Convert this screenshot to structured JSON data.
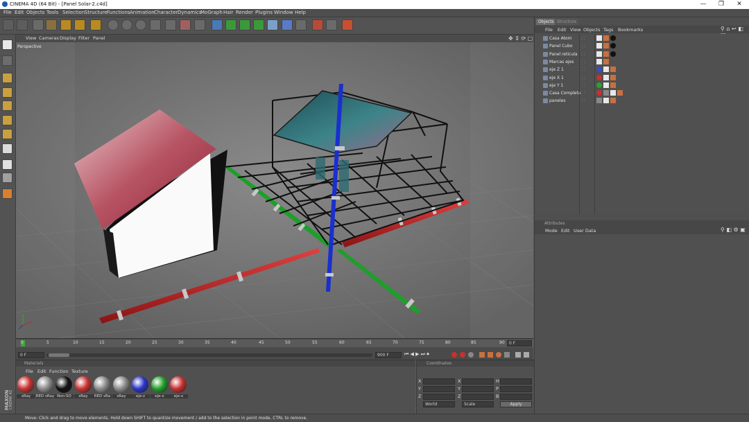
{
  "window": {
    "title": "CINEMA 4D (64 Bit) - [Panel Solar-2.c4d]",
    "controls": [
      "—",
      "❐",
      "✕"
    ]
  },
  "menubar": [
    "File",
    "Edit",
    "Objects",
    "Tools",
    "Selection",
    "Structure",
    "Functions",
    "Animation",
    "Character",
    "Dynamics",
    "MoGraph",
    "Hair",
    "Render",
    "Plugins",
    "Window",
    "Help"
  ],
  "viewport": {
    "menu": [
      "View",
      "Cameras",
      "Display",
      "Filter",
      "Panel"
    ],
    "label": "Perspective"
  },
  "timeline": {
    "ticks": [
      "0",
      "5",
      "10",
      "15",
      "20",
      "25",
      "30",
      "35",
      "40",
      "45",
      "50",
      "55",
      "60",
      "65",
      "70",
      "75",
      "80",
      "85",
      "90"
    ],
    "current_frame": "0 F",
    "start_field": "0 F",
    "end_field": "900 F",
    "right_field": "0 F"
  },
  "materials": {
    "panel_title": "Materials",
    "menu": [
      "File",
      "Edit",
      "Function",
      "Texture"
    ],
    "items": [
      {
        "label": "sRay",
        "color": "#c83232"
      },
      {
        "label": "RED sRay",
        "color": "#8a8a8a"
      },
      {
        "label": "Non-SO",
        "color": "#101010"
      },
      {
        "label": "sRay",
        "color": "#c83232"
      },
      {
        "label": "RED sRa",
        "color": "#8a8a8a"
      },
      {
        "label": "sRay",
        "color": "#8a8a8a"
      },
      {
        "label": "eje-z",
        "color": "#2a35c8"
      },
      {
        "label": "eje-x",
        "color": "#22a02a"
      },
      {
        "label": "eje-x",
        "color": "#c83030"
      }
    ]
  },
  "coordinates": {
    "panel_title": "Coordinates",
    "axes": [
      "X",
      "Y",
      "Z"
    ],
    "col2": [
      "X",
      "Y",
      "Z"
    ],
    "col3": [
      "H",
      "P",
      "B"
    ],
    "mode_world": "World",
    "mode_scale": "Scale",
    "apply_label": "Apply"
  },
  "status": {
    "text": "Move: Click and drag to move elements. Hold down SHIFT to quantize movement / add to the selection in point mode, CTRL to remove."
  },
  "maxon": {
    "line1": "MAXON",
    "line2": "CINEMA 4D"
  },
  "objects_panel": {
    "tabs": [
      "Objects",
      "Structure"
    ],
    "menu": [
      "File",
      "Edit",
      "View",
      "Objects",
      "Tags",
      "Bookmarks"
    ],
    "items": [
      {
        "name": "Casa Atom"
      },
      {
        "name": "Panel Cubo"
      },
      {
        "name": "Panel reticula"
      },
      {
        "name": "Marcas ejes"
      },
      {
        "name": "eje Z 1"
      },
      {
        "name": "eje X 1"
      },
      {
        "name": "eje Y 1"
      },
      {
        "name": "Casa Completa"
      },
      {
        "name": "paneles"
      }
    ]
  },
  "attributes_panel": {
    "title": "Attributes",
    "menu": [
      "Mode",
      "Edit",
      "User Data"
    ]
  },
  "colors": {
    "axis_x": "#c82828",
    "axis_y": "#1a2fd0",
    "axis_z": "#1f9e2a",
    "roof": "#b04050",
    "panel": "#3b6f78"
  }
}
